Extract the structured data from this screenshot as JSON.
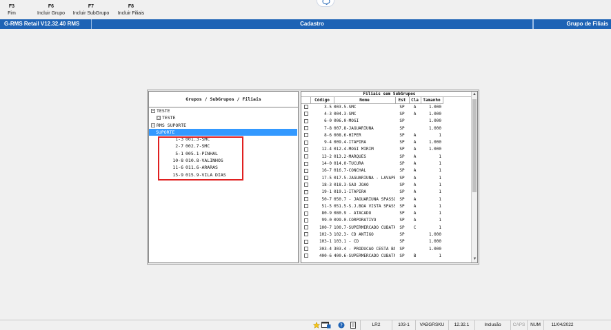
{
  "toolbar": {
    "keys": [
      {
        "key": "F3",
        "label": "Fim"
      },
      {
        "key": "F6",
        "label": "Incluir Grupo"
      },
      {
        "key": "F7",
        "label": "Incluir SubGrupo"
      },
      {
        "key": "F8",
        "label": "Incluir Filiais"
      }
    ]
  },
  "titlebar": {
    "app": "G-RMS Retail V12.32.40 RMS",
    "screen": "Cadastro",
    "module": "Grupo de Filiais"
  },
  "groups_panel": {
    "header": "Grupos / SubGrupos / Filiais",
    "nodes": [
      {
        "toggle": "−",
        "label": "TESTE"
      },
      {
        "toggle": "□",
        "label": "TESTE"
      },
      {
        "toggle": "−",
        "label": "RMS SUPORTE"
      },
      {
        "label": "SUPORTE"
      }
    ],
    "branches": [
      {
        "num": "1-3",
        "name": "001.3-SMC"
      },
      {
        "num": "2-7",
        "name": "002.7-SMC"
      },
      {
        "num": "5-1",
        "name": "005.1-PINHAL"
      },
      {
        "num": "10-8",
        "name": "010.8-VALINHOS"
      },
      {
        "num": "11-6",
        "name": "011.6-ARARAS"
      },
      {
        "num": "15-9",
        "name": "015.9-VILA DIAS"
      }
    ]
  },
  "branches_panel": {
    "title": "Filiais sem SubGrupos",
    "columns": [
      "Código",
      "Nome",
      "Est",
      "Cla",
      "Tamanho"
    ],
    "rows": [
      [
        "3-5",
        "003.5-SMC",
        "SP",
        "A",
        "1.000"
      ],
      [
        "4-3",
        "004.3-SMC",
        "SP",
        "A",
        "1.000"
      ],
      [
        "6-0",
        "006.0-MOGI",
        "SP",
        "",
        "1.000"
      ],
      [
        "7-8",
        "007.8-JAGUARIUNA",
        "SP",
        "",
        "1.000"
      ],
      [
        "8-6",
        "008.6-HIPER",
        "SP",
        "A",
        "1"
      ],
      [
        "9-4",
        "009.4-ITAPIRA",
        "SP",
        "A",
        "1.000"
      ],
      [
        "12-4",
        "012.4-MOGI MIRIM",
        "SP",
        "A",
        "1.000"
      ],
      [
        "13-2",
        "013.2-MARQUES",
        "SP",
        "A",
        "1"
      ],
      [
        "14-0",
        "014.0-TUCURA",
        "SP",
        "A",
        "1"
      ],
      [
        "16-7",
        "016.7-CONCHAL",
        "SP",
        "A",
        "1"
      ],
      [
        "17-5",
        "017.5-JAGUARIUNA - LAVAPES",
        "SP",
        "A",
        "1"
      ],
      [
        "18-3",
        "018.3-SAO JOAO",
        "SP",
        "A",
        "1"
      ],
      [
        "19-1",
        "019.1-ITAPIRA",
        "SP",
        "A",
        "1"
      ],
      [
        "50-7",
        "050.7 - JAGUARIUNA SPASSOFA",
        "SP",
        "A",
        "1"
      ],
      [
        "51-5",
        "051.5-S.J.BOA VISTA SPASSOF",
        "SP",
        "A",
        "1"
      ],
      [
        "80-9",
        "080.9 - ATACADO",
        "SP",
        "A",
        "1"
      ],
      [
        "99-0",
        "099.0-CORPORATIVO",
        "SP",
        "A",
        "1"
      ],
      [
        "100-7",
        "100.7-SUPERMERCADO CUBATAO",
        "SP",
        "C",
        "1"
      ],
      [
        "102-3",
        "102.3- CD ANTIGO",
        "SP",
        "",
        "1.000"
      ],
      [
        "103-1",
        "103.1 - CD",
        "SP",
        "",
        "1.000"
      ],
      [
        "303-4",
        "303.4 - PRODUCAO CESTA BASI",
        "SP",
        "",
        "1.000"
      ],
      [
        "400-6",
        "400.6-SUPERMERCADO CUBATAO",
        "SP",
        "B",
        "1"
      ]
    ]
  },
  "statusbar": {
    "screen_code": "LR2",
    "branch": "103-1",
    "user": "VABGRSKU",
    "version": "12.32.1",
    "mode": "Inclusão",
    "caps": "CAPS",
    "num": "NUM",
    "date": "11/04/2022"
  },
  "colors": {
    "titlebar": "#1e63b5",
    "selection": "#3399ff",
    "highlight_box": "#e02020"
  }
}
